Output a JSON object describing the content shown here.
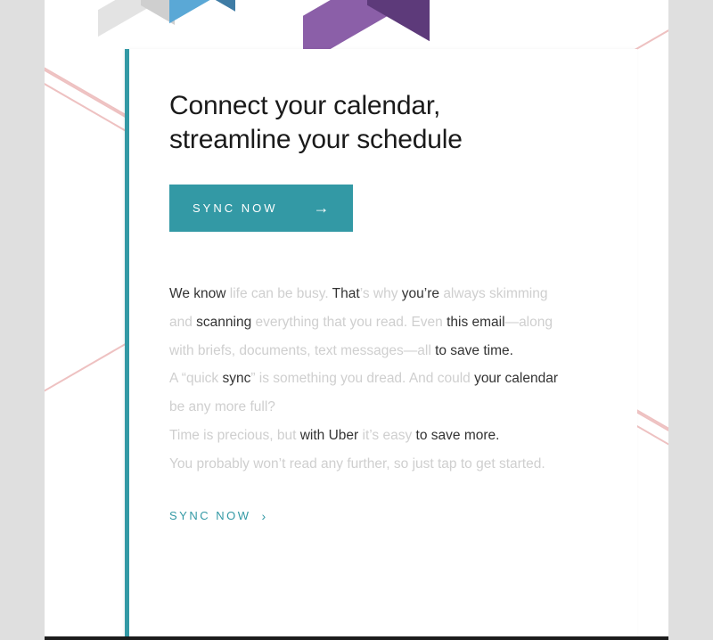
{
  "heading": {
    "line1": "Connect your calendar,",
    "line2": "streamline your schedule"
  },
  "cta_button": {
    "label": "SYNC NOW",
    "arrow_glyph": "→"
  },
  "body": {
    "segments": [
      {
        "t": "We know ",
        "d": true
      },
      {
        "t": "life can be busy. ",
        "d": false
      },
      {
        "t": "That",
        "d": true
      },
      {
        "t": "’s why ",
        "d": false
      },
      {
        "t": "you’re ",
        "d": true
      },
      {
        "t": "always skimming and ",
        "d": false
      },
      {
        "t": "scanning ",
        "d": true
      },
      {
        "t": "everything that you read. Even ",
        "d": false
      },
      {
        "t": "this email",
        "d": true
      },
      {
        "t": "—along with briefs, documents, text messages—all ",
        "d": false
      },
      {
        "t": "to save time.",
        "d": true
      },
      {
        "t": "\nA “quick ",
        "d": false
      },
      {
        "t": "sync",
        "d": true
      },
      {
        "t": "” is something you dread. And could ",
        "d": false
      },
      {
        "t": "your calendar ",
        "d": true
      },
      {
        "t": "be any more full?\nTime is precious, but ",
        "d": false
      },
      {
        "t": "with Uber ",
        "d": true
      },
      {
        "t": "it’s easy ",
        "d": false
      },
      {
        "t": "to save more.",
        "d": true
      },
      {
        "t": "\nYou probably won’t read any further, so just tap to get started.",
        "d": false
      }
    ]
  },
  "cta_link": {
    "label": "SYNC NOW",
    "chevron_glyph": "›"
  },
  "colors": {
    "accent": "#3399a5",
    "text_dark": "#333333",
    "text_faded": "#cfcfcf"
  }
}
